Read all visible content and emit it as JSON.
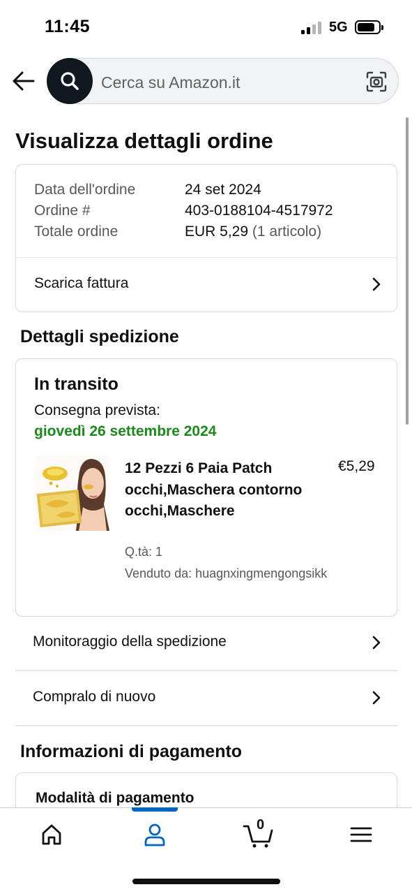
{
  "status_bar": {
    "time": "11:45",
    "network": "5G",
    "icons": [
      "signal-icon",
      "battery-icon"
    ]
  },
  "search": {
    "placeholder": "Cerca su Amazon.it",
    "icons": [
      "back-arrow-icon",
      "search-icon",
      "camera-icon"
    ]
  },
  "page": {
    "title": "Visualizza dettagli ordine"
  },
  "order": {
    "rows": [
      {
        "label": "Data dell'ordine",
        "value": "24 set 2024"
      },
      {
        "label": "Ordine #",
        "value": "403-0188104-4517972"
      },
      {
        "label": "Totale ordine",
        "value": "EUR 5,29",
        "suffix": "(1 articolo)"
      }
    ],
    "invoice_label": "Scarica fattura"
  },
  "shipment": {
    "section_title": "Dettagli spedizione",
    "status": "In transito",
    "expected_label": "Consegna prevista:",
    "expected_date": "giovedì 26 settembre 2024",
    "product": {
      "title": "12 Pezzi 6 Paia Patch occhi,Maschera contorno occhi,Maschere",
      "price": "€5,29",
      "qty": "Q.tà: 1",
      "seller": "Venduto da: huagnxingmengongsikk"
    },
    "track_label": "Monitoraggio della spedizione",
    "buy_again_label": "Compralo di nuovo"
  },
  "payment": {
    "section_title": "Informazioni di pagamento",
    "method_label": "Modalità di pagamento"
  },
  "bottom_nav": {
    "items": [
      "home-icon",
      "account-icon",
      "cart-icon",
      "menu-icon"
    ],
    "active": "account-icon",
    "cart_count": "0"
  },
  "colors": {
    "delivery_green": "#1a8a1a",
    "nav_active": "#0066c0",
    "search_button": "#101820"
  }
}
